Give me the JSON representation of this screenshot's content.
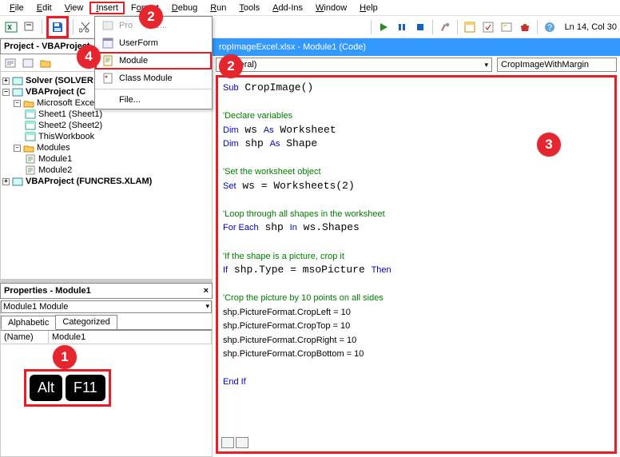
{
  "menu": {
    "file": "File",
    "edit": "Edit",
    "view": "View",
    "insert": "Insert",
    "format": "Format",
    "debug": "Debug",
    "run": "Run",
    "tools": "Tools",
    "addins": "Add-Ins",
    "window": "Window",
    "help": "Help"
  },
  "toolbar": {
    "lncol": "Ln 14, Col 30"
  },
  "titlebar": "ropImageExcel.xlsx - Module1 (Code)",
  "dropdown": {
    "procedure": "Procedure...",
    "userform": "UserForm",
    "module": "Module",
    "classmodule": "Class Module",
    "file": "File..."
  },
  "project": {
    "title": "Project - VBAProject",
    "solver": "Solver (SOLVER",
    "vbaproj": "VBAProject (C",
    "msobj": "Microsoft Excel Objects",
    "sheet1": "Sheet1 (Sheet1)",
    "sheet2": "Sheet2 (Sheet2)",
    "thiswb": "ThisWorkbook",
    "modules": "Modules",
    "module1": "Module1",
    "module2": "Module2",
    "funcres": "VBAProject (FUNCRES.XLAM)"
  },
  "props": {
    "title": "Properties - Module1",
    "combo": "Module1 Module",
    "tab_alpha": "Alphabetic",
    "tab_cat": "Categorized",
    "name_label": "(Name)",
    "name_value": "Module1"
  },
  "combo": {
    "left": "(General)",
    "right": "CropImageWithMargin"
  },
  "code": {
    "l1": "Sub CropImage()",
    "l2": "'Declare variables",
    "l3": "Dim ws As Worksheet",
    "l4": "Dim shp As Shape",
    "l5": "'Set the worksheet object",
    "l6": "Set ws = Worksheets(2)",
    "l7": "'Loop through all shapes in the worksheet",
    "l8": "For Each shp In ws.Shapes",
    "l9": "'If the shape is a picture, crop it",
    "l10": "If shp.Type = msoPicture Then",
    "l11": "'Crop the picture by 10 points on all sides",
    "l12": "shp.PictureFormat.CropLeft = 10",
    "l13": "shp.PictureFormat.CropTop = 10",
    "l14": "shp.PictureFormat.CropRight = 10",
    "l15": "shp.PictureFormat.CropBottom = 10",
    "l16": "End If"
  },
  "keys": {
    "alt": "Alt",
    "f11": "F11"
  },
  "badges": {
    "b1": "1",
    "b2a": "2",
    "b2b": "2",
    "b3": "3",
    "b4": "4"
  }
}
